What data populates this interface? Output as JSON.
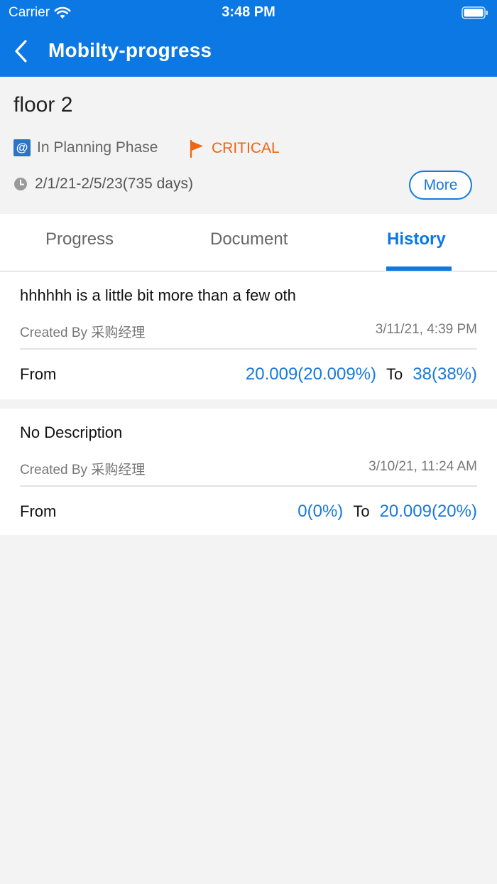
{
  "status_bar": {
    "carrier": "Carrier",
    "time": "3:48 PM",
    "wifi_icon": "wifi-icon",
    "battery_icon": "battery-icon"
  },
  "nav": {
    "title": "Mobilty-progress",
    "back_icon": "chevron-left-icon"
  },
  "project": {
    "name": "floor 2",
    "phase_icon_glyph": "@",
    "phase": "In Planning Phase",
    "priority": "CRITICAL",
    "priority_color": "#ee6611",
    "date_range": "2/1/21-2/5/23(735 days)",
    "more_label": "More"
  },
  "tabs": [
    {
      "label": "Progress",
      "active": false
    },
    {
      "label": "Document",
      "active": false
    },
    {
      "label": "History",
      "active": true
    }
  ],
  "history": [
    {
      "description": "hhhhhh is a little bit more than a few oth",
      "created_by": "Created By 采购经理",
      "date": "3/11/21, 4:39 PM",
      "from_label": "From",
      "from_value": "20.009(20.009%)",
      "to_label": "To",
      "to_value": "38(38%)"
    },
    {
      "description": "No Description",
      "created_by": "Created By 采购经理",
      "date": "3/10/21, 11:24 AM",
      "from_label": "From",
      "from_value": "0(0%)",
      "to_label": "To",
      "to_value": "20.009(20%)"
    }
  ],
  "colors": {
    "accent": "#0b78e3",
    "link": "#1679dc",
    "background": "#f3f3f3"
  }
}
